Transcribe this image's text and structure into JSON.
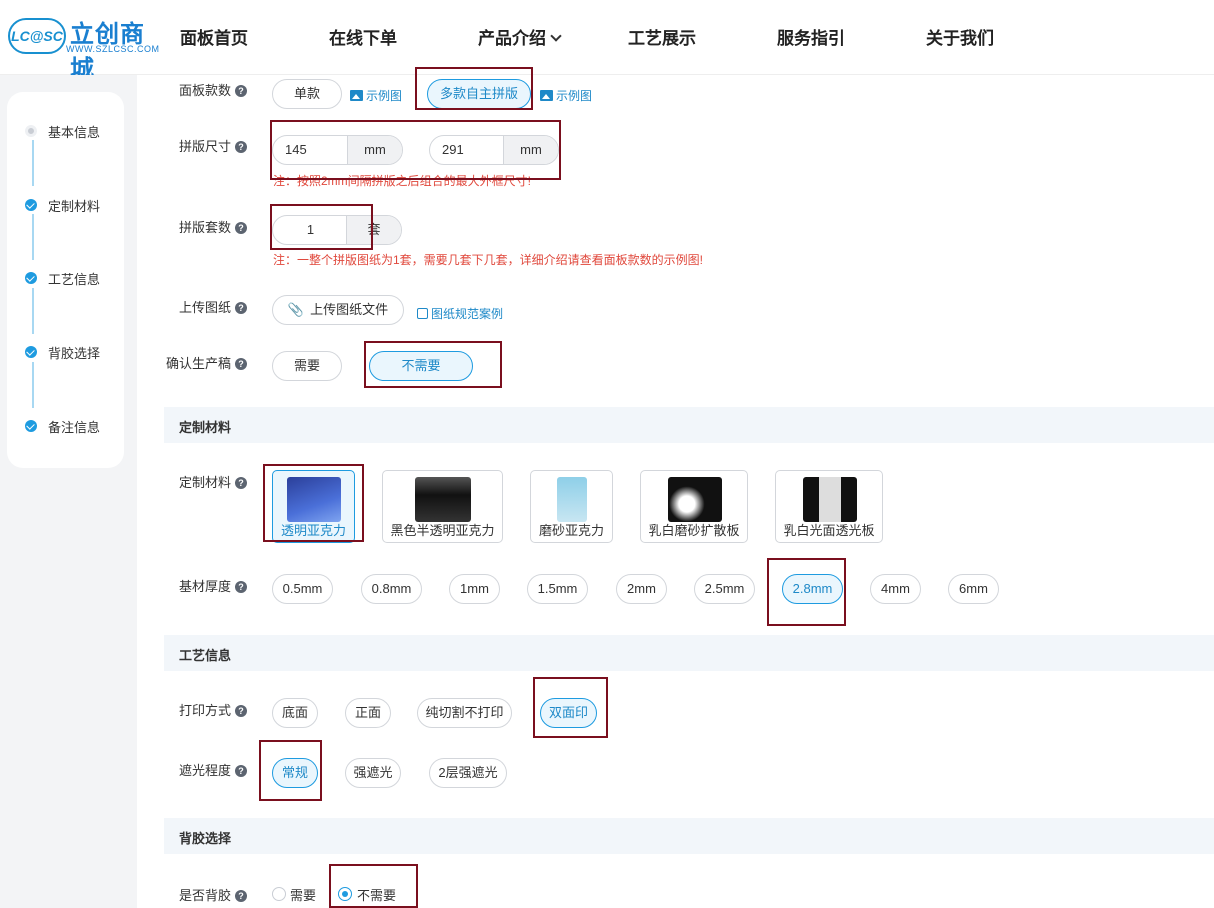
{
  "header": {
    "logo_badge": "LC@SC",
    "logo_name": "立创商城",
    "logo_url": "WWW.SZLCSC.COM",
    "nav": [
      "面板首页",
      "在线下单",
      "产品介绍",
      "工艺展示",
      "服务指引",
      "关于我们"
    ]
  },
  "sidebar": {
    "steps": [
      {
        "label": "基本信息",
        "state": "current"
      },
      {
        "label": "定制材料",
        "state": "done"
      },
      {
        "label": "工艺信息",
        "state": "done"
      },
      {
        "label": "背胶选择",
        "state": "done"
      },
      {
        "label": "备注信息",
        "state": "done"
      }
    ]
  },
  "form": {
    "panel_count": {
      "label": "面板款数",
      "options": [
        "单款",
        "多款自主拼版"
      ],
      "selected": "多款自主拼版",
      "example_link": "示例图"
    },
    "panel_size": {
      "label": "拼版尺寸",
      "width": "145",
      "height": "291",
      "unit": "mm",
      "note": "注：按照2mm间隔拼版之后组合的最大外框尺寸!"
    },
    "panel_sets": {
      "label": "拼版套数",
      "value": "1",
      "unit": "套",
      "note": "注：一整个拼版图纸为1套，需要几套下几套，详细介绍请查看面板款数的示例图!"
    },
    "upload": {
      "label": "上传图纸",
      "button": "上传图纸文件",
      "example_link": "图纸规范案例"
    },
    "confirm": {
      "label": "确认生产稿",
      "options": [
        "需要",
        "不需要"
      ],
      "selected": "不需要"
    }
  },
  "sections": {
    "material": "定制材料",
    "process": "工艺信息",
    "adhesive": "背胶选择"
  },
  "material": {
    "label": "定制材料",
    "options": [
      "透明亚克力",
      "黑色半透明亚克力",
      "磨砂亚克力",
      "乳白磨砂扩散板",
      "乳白光面透光板"
    ],
    "selected": "透明亚克力",
    "thickness_label": "基材厚度",
    "thickness_options": [
      "0.5mm",
      "0.8mm",
      "1mm",
      "1.5mm",
      "2mm",
      "2.5mm",
      "2.8mm",
      "4mm",
      "6mm"
    ],
    "thickness_selected": "2.8mm"
  },
  "process": {
    "print_label": "打印方式",
    "print_options": [
      "底面",
      "正面",
      "纯切割不打印",
      "双面印"
    ],
    "print_selected": "双面印",
    "shade_label": "遮光程度",
    "shade_options": [
      "常规",
      "强遮光",
      "2层强遮光"
    ],
    "shade_selected": "常规"
  },
  "adhesive": {
    "label": "是否背胶",
    "options": [
      "需要",
      "不需要"
    ],
    "selected": "不需要"
  },
  "colors": {
    "accent": "#1e9be0",
    "highlight_box": "#7a0f1e",
    "note_red": "#e0483c"
  }
}
